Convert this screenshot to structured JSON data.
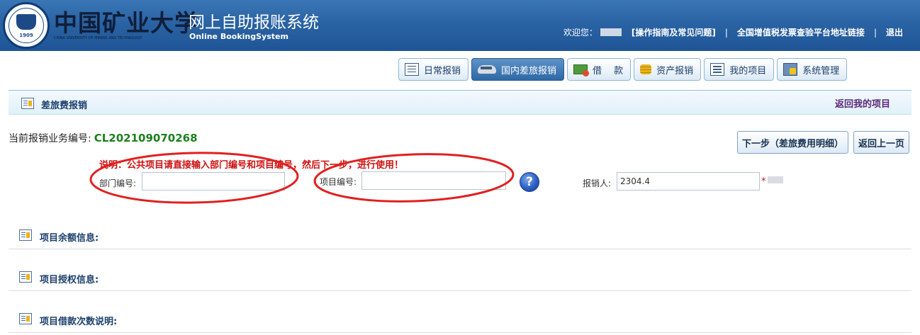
{
  "header": {
    "university_name": "中国矿业大学",
    "university_name_en": "CHINA UNIVERSITY OF MINING AND TECHNOLOGY",
    "seal_year": "1909",
    "system_title": "网上自助报账系统",
    "system_subtitle": "Online BookingSystem",
    "welcome_label": "欢迎您：",
    "guide_link": "[操作指南及常见问题]",
    "separator": "|",
    "invoice_link": "全国增值税发票查验平台地址链接",
    "logout_link": "退出"
  },
  "nav": {
    "tabs": [
      {
        "label": "日常报销",
        "icon": "document-icon",
        "active": false
      },
      {
        "label": "国内差旅报销",
        "icon": "train-icon",
        "active": true
      },
      {
        "label": "借　 款",
        "icon": "money-icon",
        "active": false
      },
      {
        "label": "资产报销",
        "icon": "coin-icon",
        "active": false
      },
      {
        "label": "我的项目",
        "icon": "list-icon",
        "active": false
      },
      {
        "label": "系统管理",
        "icon": "management-icon",
        "active": false
      }
    ]
  },
  "section": {
    "title": "差旅费报销",
    "back_link": "返回我的项目"
  },
  "business": {
    "label": "当前报销业务编号:",
    "number": "CL202109070268"
  },
  "buttons": {
    "next": "下一步（差旅费用明细）",
    "back": "返回上一页"
  },
  "notice": "说明：公共项目请直接输入部门编号和项目编号，然后下一步，进行使用！",
  "form": {
    "dept_label": "部门编号:",
    "dept_value": "",
    "project_label": "项目编号:",
    "project_value": "",
    "help_symbol": "?",
    "claimer_label": "报销人:",
    "claimer_value": "2304.4",
    "required_mark": "*"
  },
  "info_sections": [
    {
      "title": "项目余额信息:"
    },
    {
      "title": "项目授权信息:"
    },
    {
      "title": "项目借款次数说明:"
    }
  ],
  "colors": {
    "header_blue": "#2a63a3",
    "active_tab": "#2e69a6",
    "business_number": "#1d7f1d",
    "notice_red": "#cc1111",
    "annotation_red": "#e0201f"
  }
}
